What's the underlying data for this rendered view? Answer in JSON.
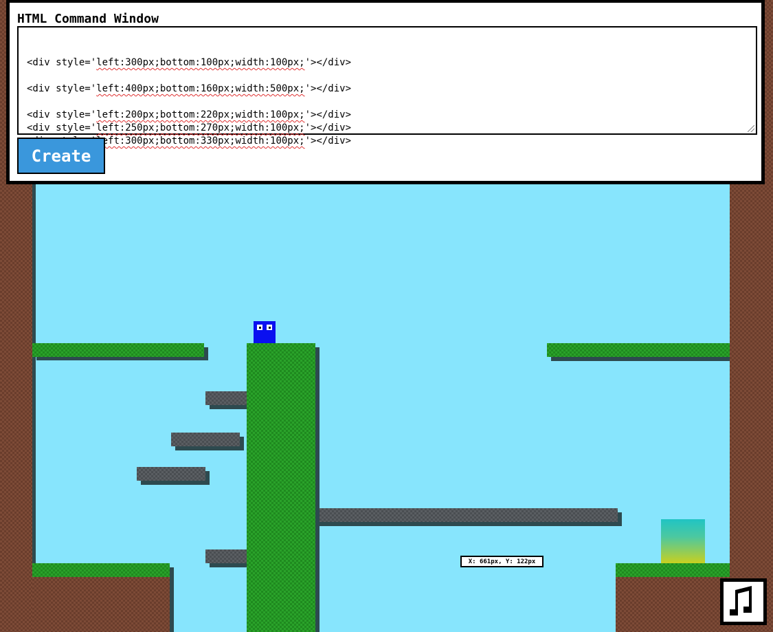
{
  "command_window": {
    "title": "HTML Command Window",
    "lines": [
      {
        "pre": "<div style='",
        "style": "left:300px;bottom:100px;width:100px;",
        "post": "'></div>"
      },
      {
        "pre": "",
        "style": "",
        "post": ""
      },
      {
        "pre": "<div style='",
        "style": "left:400px;bottom:160px;width:500px;",
        "post": "'></div>"
      },
      {
        "pre": "",
        "style": "",
        "post": ""
      },
      {
        "pre": "<div style='",
        "style": "left:200px;bottom:220px;width:100px;",
        "post": "'></div>"
      },
      {
        "pre": "<div style='",
        "style": "left:250px;bottom:270px;width:100px;",
        "post": "'></div>"
      },
      {
        "pre": "<div style='",
        "style": "left:300px;bottom:330px;width:100px;",
        "post": "'></div>"
      }
    ],
    "create_label": "Create"
  },
  "coordinate_readout": "X: 661px, Y: 122px",
  "icons": {
    "music": "music-note-icon"
  },
  "colors": {
    "sky": "#87e5fd",
    "grass": "#2aa22a",
    "stone": "#5a5e62",
    "dirt": "#7d4b37",
    "player": "#0a10f0",
    "button": "#3a97dc"
  }
}
